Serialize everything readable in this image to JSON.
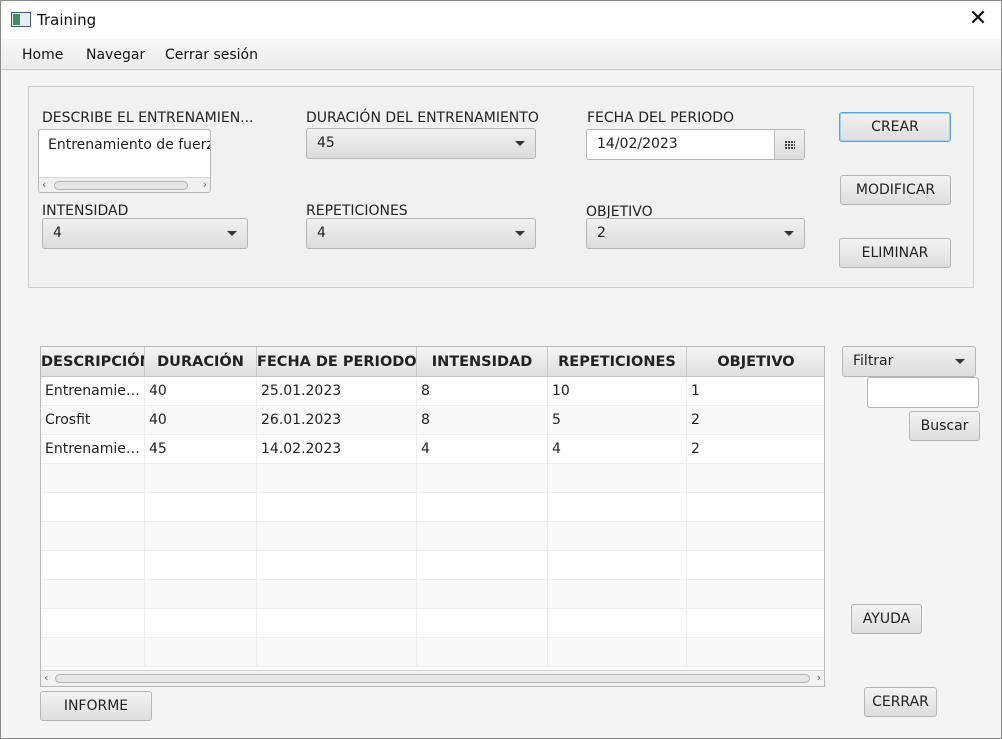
{
  "window": {
    "title": "Training",
    "close_glyph": "✕"
  },
  "menu": {
    "items": [
      "Home",
      "Navegar",
      "Cerrar sesión"
    ]
  },
  "form": {
    "description": {
      "label": "DESCRIBE EL ENTRENAMIEN...",
      "value": "Entrenamiento de fuerza"
    },
    "duration": {
      "label": "DURACIÓN DEL ENTRENAMIENTO",
      "value": "45"
    },
    "date": {
      "label": "FECHA DEL PERIODO",
      "value": "14/02/2023"
    },
    "intensity": {
      "label": "INTENSIDAD",
      "value": "4"
    },
    "repetitions": {
      "label": "REPETICIONES",
      "value": "4"
    },
    "objective": {
      "label": "OBJETIVO",
      "value": "2"
    }
  },
  "actions": {
    "create": "CREAR",
    "modify": "MODIFICAR",
    "delete": "ELIMINAR"
  },
  "table": {
    "columns": [
      "DESCRIPCIÓN",
      "DURACIÓN",
      "FECHA DE PERIODO",
      "INTENSIDAD",
      "REPETICIONES",
      "OBJETIVO"
    ],
    "rows": [
      [
        "Entrenamiento de fuerza",
        "40",
        "25.01.2023",
        "8",
        "10",
        "1"
      ],
      [
        "Crosfit",
        "40",
        "26.01.2023",
        "8",
        "5",
        "2"
      ],
      [
        "Entrenamiento de fuerza",
        "45",
        "14.02.2023",
        "4",
        "4",
        "2"
      ],
      [
        "",
        "",
        "",
        "",
        "",
        ""
      ],
      [
        "",
        "",
        "",
        "",
        "",
        ""
      ],
      [
        "",
        "",
        "",
        "",
        "",
        ""
      ],
      [
        "",
        "",
        "",
        "",
        "",
        ""
      ],
      [
        "",
        "",
        "",
        "",
        "",
        ""
      ],
      [
        "",
        "",
        "",
        "",
        "",
        ""
      ],
      [
        "",
        "",
        "",
        "",
        "",
        ""
      ]
    ]
  },
  "filter": {
    "selected": "Filtrar",
    "search_value": "",
    "search_button": "Buscar"
  },
  "footer": {
    "report": "INFORME",
    "help": "AYUDA",
    "close": "CERRAR"
  },
  "icons": {
    "calendar": "calendar-icon",
    "dropdown": "chevron-down-icon",
    "close": "close-icon",
    "app": "java-app-icon"
  }
}
